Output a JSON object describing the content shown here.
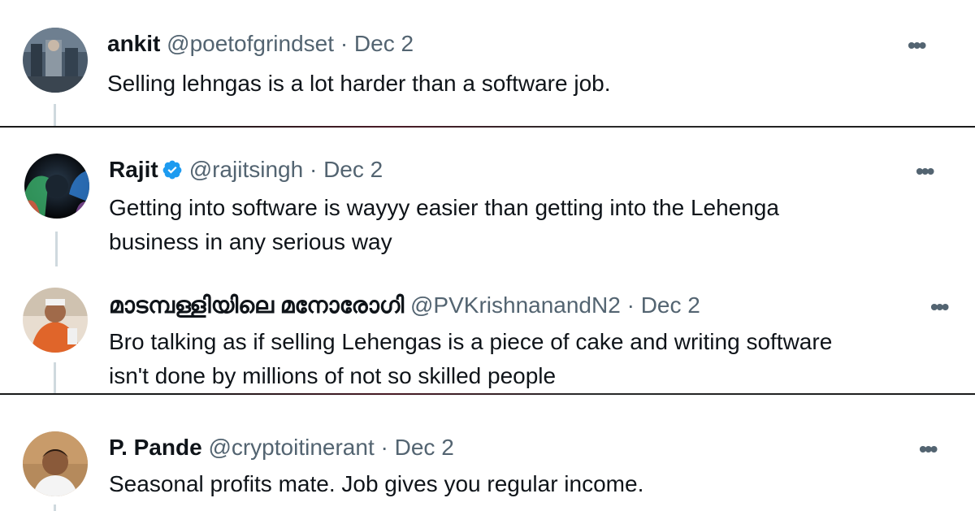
{
  "tweets": [
    {
      "name": "ankit",
      "handle": "@poetofgrindset",
      "separator": "·",
      "date": "Dec 2",
      "text_lines": [
        "Selling lehngas is a lot harder than a software job."
      ],
      "verified": false
    },
    {
      "name": "Rajit",
      "handle": "@rajitsingh",
      "separator": "·",
      "date": "Dec 2",
      "text_lines": [
        "Getting into software is wayyy easier than getting into the Lehenga",
        "business in any serious way"
      ],
      "verified": true
    },
    {
      "name": "മാടമ്പള്ളിയിലെ മനോരോഗി",
      "handle": "@PVKrishnanandN2",
      "separator": "·",
      "date": "Dec 2",
      "text_lines": [
        "Bro talking as if selling Lehengas is a piece of cake and writing software",
        "isn't done by millions of not so skilled people"
      ],
      "verified": false
    },
    {
      "name": "P. Pande",
      "handle": "@cryptoitinerant",
      "separator": "·",
      "date": "Dec 2",
      "text_lines": [
        "Seasonal profits mate. Job gives you regular income."
      ],
      "verified": false
    }
  ],
  "more_label": "•••",
  "colors": {
    "text": "#0f1419",
    "secondary": "#536471",
    "verified": "#1d9bf0",
    "thread_line": "#cfd9de"
  },
  "icons": {
    "more": "more-options-icon",
    "verified": "verified-badge-icon"
  }
}
